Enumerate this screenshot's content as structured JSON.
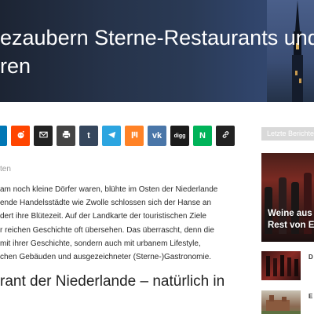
{
  "hero": {
    "title_lines": [
      "ezaubern Sterne-Restaurants und",
      "ren"
    ]
  },
  "share": {
    "buttons": [
      {
        "icon": "linkedin-icon",
        "color": "#0077b5",
        "label": ""
      },
      {
        "icon": "reddit-icon",
        "color": "#ff4500",
        "label": ""
      },
      {
        "icon": "email-icon",
        "color": "#222222",
        "label": ""
      },
      {
        "icon": "print-icon",
        "color": "#444444",
        "label": ""
      },
      {
        "icon": "tumblr-icon",
        "color": "#35465c",
        "label": "t"
      },
      {
        "icon": "telegram-icon",
        "color": "#2ca5e0",
        "label": ""
      },
      {
        "icon": "mix-icon",
        "color": "#ff8226",
        "label": ""
      },
      {
        "icon": "vk-icon",
        "color": "#4a76a8",
        "label": "vk"
      },
      {
        "icon": "digg-icon",
        "color": "#1b1b1b",
        "label": "digg"
      },
      {
        "icon": "xing-icon",
        "color": "#00b359",
        "label": "N"
      },
      {
        "icon": "link-icon",
        "color": "#222222",
        "label": ""
      }
    ]
  },
  "article": {
    "meta": "ten",
    "body_lines": [
      "am noch kleine Dörfer waren, blühte im Osten der Niederlande",
      "ende Handelsstädte wie Zwolle schlossen sich der Hanse an",
      "dert ihre Blütezeit. Auf der Landkarte der touristischen Ziele",
      "r reichen Geschichte oft übersehen. Das überrascht, denn die",
      "mit ihrer Geschichte, sondern auch mit urbanem Lifestyle,",
      "chen Gebäuden und ausgezeichneter (Sterne-)Gastronomie."
    ],
    "subhead_lines": [
      "rant der Niederlande – natürlich in"
    ]
  },
  "sidebar": {
    "header": "Letzte Berichte",
    "feature_caption_lines": [
      "Weine aus C",
      "Rest von Eu"
    ],
    "thumb1_initial": "D",
    "thumb2_initial": "E"
  }
}
